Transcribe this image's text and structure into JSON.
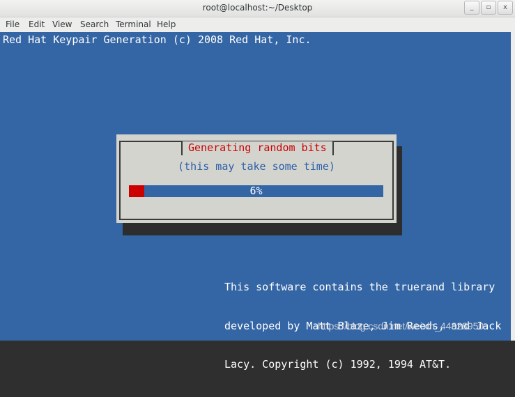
{
  "window": {
    "title": "root@localhost:~/Desktop",
    "buttons": {
      "minimize": "_",
      "maximize": "▫",
      "close": "x"
    }
  },
  "menu": [
    "File",
    "Edit",
    "View",
    "Search",
    "Terminal",
    "Help"
  ],
  "terminal": {
    "header": "Red Hat Keypair Generation (c) 2008 Red Hat, Inc.",
    "dialog": {
      "title": "Generating random bits",
      "message": "(this may take some time)",
      "progress_label": "6%",
      "progress_fraction": 0.06
    },
    "footer_lines": [
      "This software contains the truerand library",
      "developed by Matt Blaze, Jim Reeds, and Jack",
      "Lacy. Copyright (c) 1992, 1994 AT&T."
    ]
  },
  "watermark": "https://blog.csdn.net/weixin_44828950",
  "colors": {
    "terminal_bg": "#3465a4",
    "dialog_bg": "#d4d4cf",
    "accent_red": "#cc0000"
  }
}
